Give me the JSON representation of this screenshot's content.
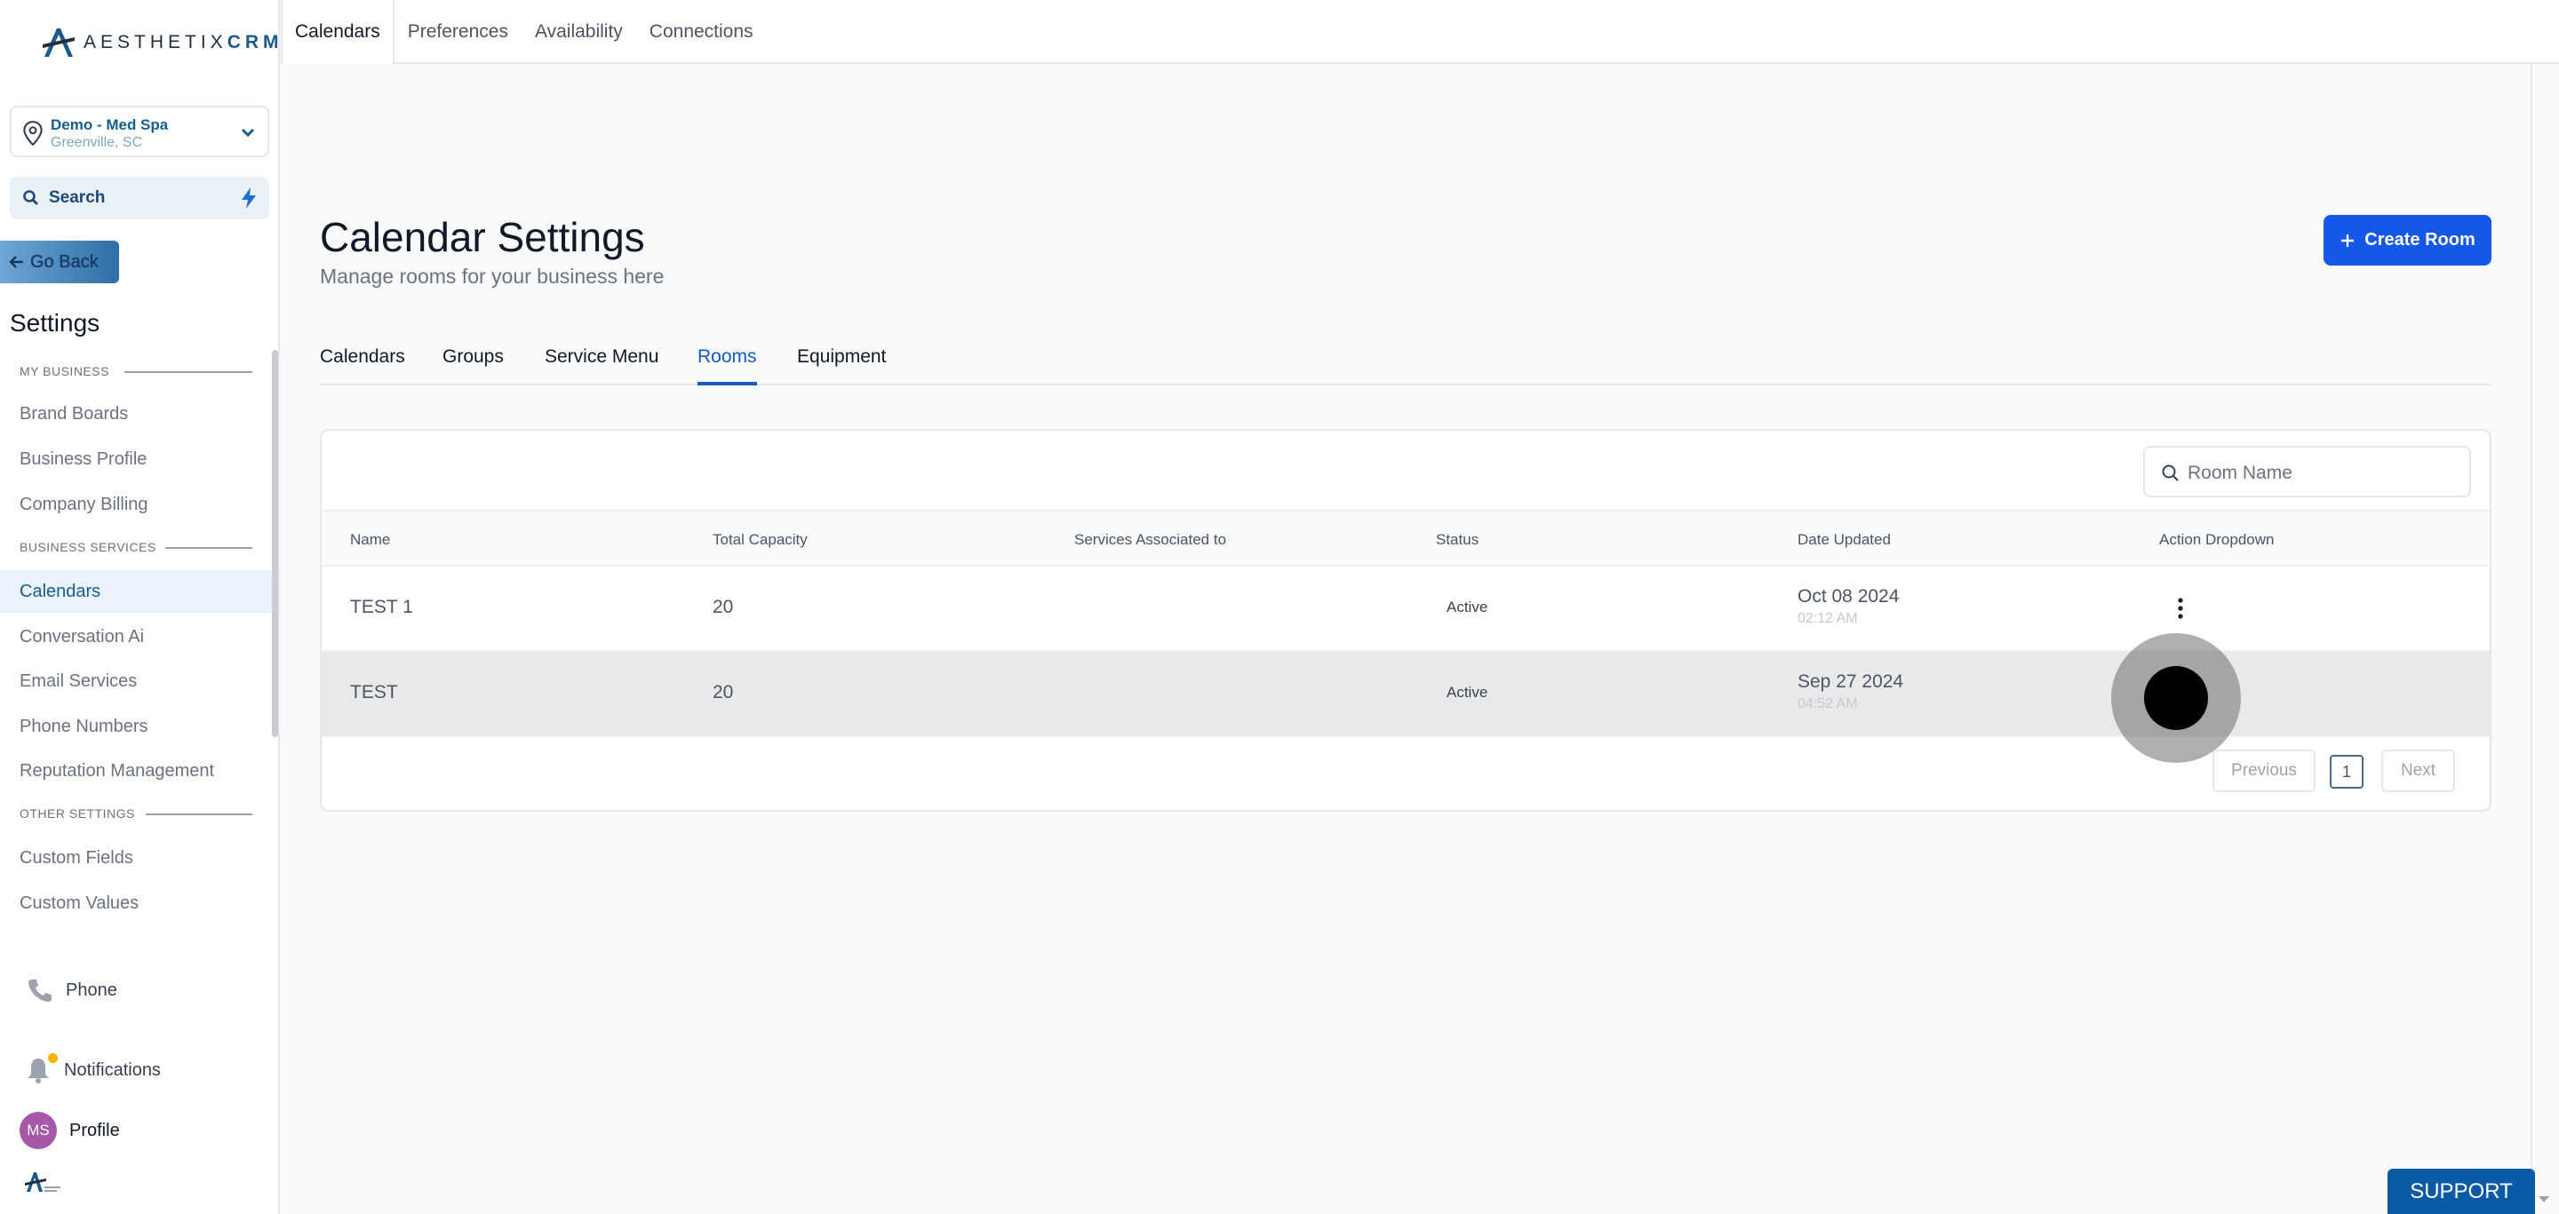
{
  "brand": {
    "logo_main": "AESTHETIX",
    "logo_accent": "CRM"
  },
  "location": {
    "name": "Demo - Med Spa",
    "city": "Greenville, SC"
  },
  "sidebar": {
    "search_label": "Search",
    "go_back": "Go Back",
    "settings_title": "Settings",
    "sections": {
      "my_business": "MY BUSINESS",
      "business_services": "BUSINESS SERVICES",
      "other_settings": "OTHER SETTINGS"
    },
    "items": [
      {
        "label": "Brand Boards"
      },
      {
        "label": "Business Profile"
      },
      {
        "label": "Company Billing"
      },
      {
        "label": "Calendars"
      },
      {
        "label": "Conversation Ai"
      },
      {
        "label": "Email Services"
      },
      {
        "label": "Phone Numbers"
      },
      {
        "label": "Reputation Management"
      },
      {
        "label": "Custom Fields"
      },
      {
        "label": "Custom Values"
      }
    ],
    "bottom": {
      "phone": "Phone",
      "notifications": "Notifications",
      "profile": "Profile",
      "avatar_initials": "MS"
    }
  },
  "topbar": {
    "tabs": [
      "Calendars",
      "Preferences",
      "Availability",
      "Connections"
    ],
    "active": "Calendars"
  },
  "page": {
    "title": "Calendar Settings",
    "subtitle": "Manage rooms for your business here",
    "create_button": "Create Room",
    "tabs": [
      "Calendars",
      "Groups",
      "Service Menu",
      "Rooms",
      "Equipment"
    ],
    "active_tab": "Rooms"
  },
  "table": {
    "search_placeholder": "Room Name",
    "columns": [
      "Name",
      "Total Capacity",
      "Services Associated to",
      "Status",
      "Date Updated",
      "Action Dropdown"
    ],
    "rows": [
      {
        "name": "TEST 1",
        "capacity": "20",
        "services": "",
        "status": "Active",
        "date": "Oct 08 2024",
        "time": "02:12 AM"
      },
      {
        "name": "TEST",
        "capacity": "20",
        "services": "",
        "status": "Active",
        "date": "Sep 27 2024",
        "time": "04:52 AM"
      }
    ],
    "pagination": {
      "previous": "Previous",
      "page": "1",
      "next": "Next"
    }
  },
  "support_label": "SUPPORT",
  "colors": {
    "primary": "#1558e8",
    "brand": "#155e95",
    "support": "#0b5aa6"
  }
}
